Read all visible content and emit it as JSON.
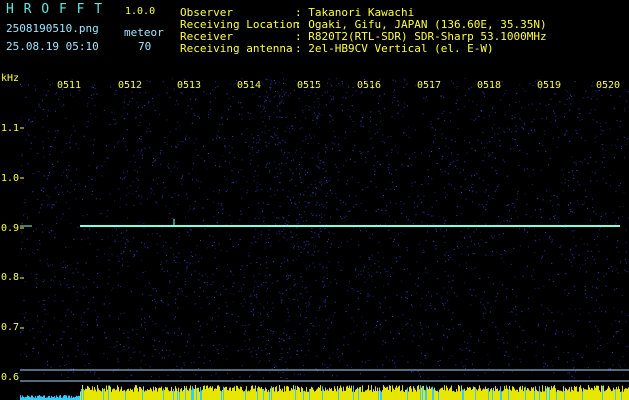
{
  "app": {
    "name": "H R O F F T",
    "version": "1.0.0"
  },
  "file": {
    "name": "2508190510.png",
    "datetime": "25.08.19 05:10"
  },
  "meteor": {
    "label": "meteor",
    "count": "70"
  },
  "info": [
    {
      "key": "Observer",
      "value": ": Takanori Kawachi"
    },
    {
      "key": "Receiving Location",
      "value": ": Ogaki, Gifu, JAPAN (136.60E, 35.35N)"
    },
    {
      "key": "Receiver",
      "value": ": R820T2(RTL-SDR) SDR-Sharp 53.1000MHz"
    },
    {
      "key": "Receiving antenna",
      "value": ": 2el-HB9CV Vertical (el. E-W)"
    }
  ],
  "axis": {
    "unit": "kHz",
    "y_ticks": [
      "1.1",
      "1.0",
      "0.9",
      "0.8",
      "0.7",
      "0.6"
    ],
    "x_ticks": [
      "0511",
      "0512",
      "0513",
      "0514",
      "0515",
      "0516",
      "0517",
      "0518",
      "0519",
      "0520"
    ]
  },
  "colors": {
    "background": "#000000",
    "label": "#ffff40",
    "noise": "#1a2a8a",
    "signal": "#7fffe0",
    "bottom_bar": "#e6e600",
    "bottom_low": "#33ccff"
  }
}
